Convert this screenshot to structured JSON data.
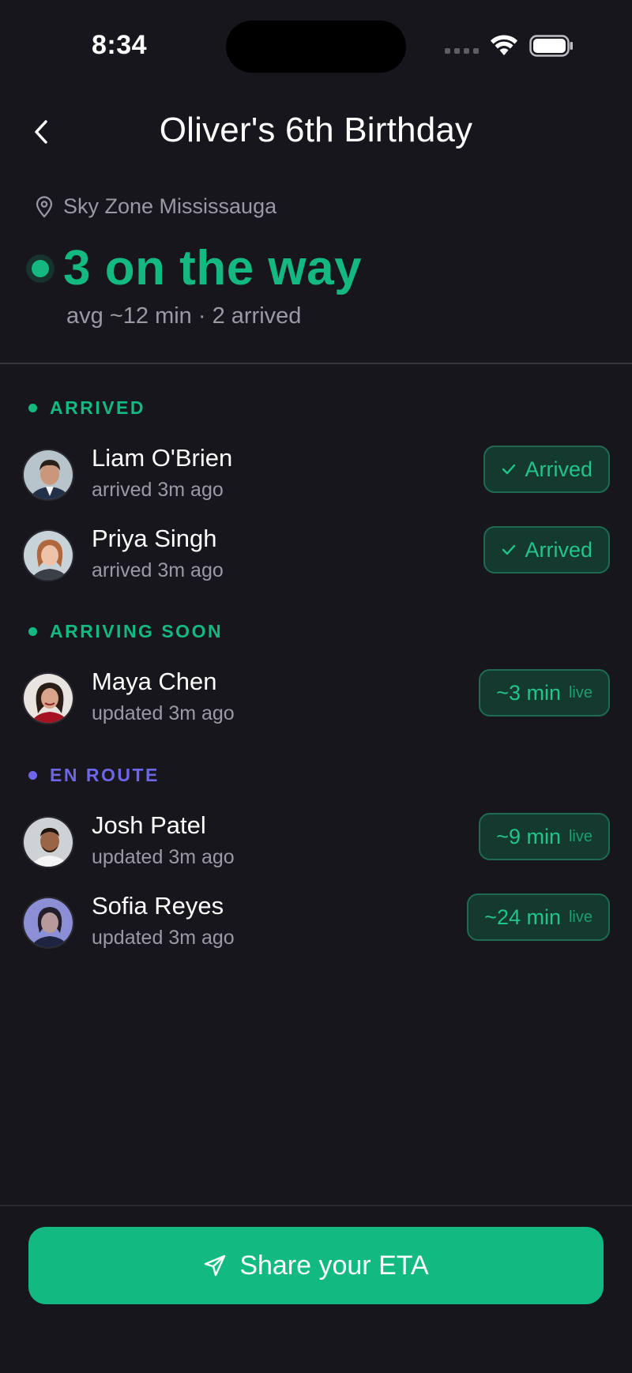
{
  "status_bar": {
    "time": "8:34"
  },
  "header": {
    "title": "Oliver's 6th Birthday"
  },
  "summary": {
    "location": "Sky Zone Mississauga",
    "headline": "3 on the way",
    "subline": "avg ~12 min · 2 arrived"
  },
  "colors": {
    "accent": "#14b981",
    "en_route": "#6d66e8",
    "background": "#17161c",
    "muted_text": "#9b9aa3"
  },
  "sections": {
    "arrived": {
      "label": "ARRIVED",
      "guests": [
        {
          "name": "Liam O'Brien",
          "meta": "arrived 3m ago",
          "badge": "Arrived",
          "icon": "check-icon"
        },
        {
          "name": "Priya Singh",
          "meta": "arrived 3m ago",
          "badge": "Arrived",
          "icon": "check-icon"
        }
      ]
    },
    "arriving_soon": {
      "label": "ARRIVING SOON",
      "guests": [
        {
          "name": "Maya Chen",
          "meta": "updated 3m ago",
          "eta": "~3 min",
          "live": "live"
        }
      ]
    },
    "en_route": {
      "label": "EN ROUTE",
      "guests": [
        {
          "name": "Josh Patel",
          "meta": "updated 3m ago",
          "eta": "~9 min",
          "live": "live"
        },
        {
          "name": "Sofia Reyes",
          "meta": "updated 3m ago",
          "eta": "~24 min",
          "live": "live"
        }
      ]
    }
  },
  "cta": {
    "label": "Share your ETA",
    "icon": "send-icon"
  }
}
